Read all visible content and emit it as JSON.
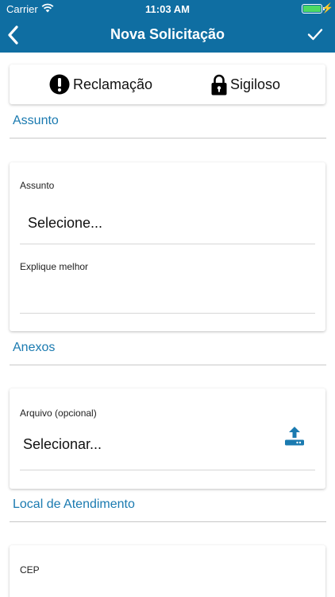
{
  "status_bar": {
    "carrier": "Carrier",
    "time": "11:03 AM",
    "battery_level": 1.0
  },
  "nav": {
    "title": "Nova Solicitação"
  },
  "type_options": [
    {
      "label": "Reclamação",
      "icon": "exclamation-circle-icon"
    },
    {
      "label": "Sigiloso",
      "icon": "lock-icon"
    }
  ],
  "sections": {
    "assunto": {
      "title": "Assunto",
      "subject_label": "Assunto",
      "subject_value": "Selecione...",
      "explain_label": "Explique melhor"
    },
    "anexos": {
      "title": "Anexos",
      "file_label": "Arquivo (opcional)",
      "file_value": "Selecionar...",
      "icon": "upload-icon"
    },
    "local": {
      "title": "Local de Atendimento",
      "cep_label": "CEP"
    }
  },
  "colors": {
    "primary": "#0f6ea2",
    "section_title": "#1a7ab0",
    "battery": "#4cd964"
  }
}
